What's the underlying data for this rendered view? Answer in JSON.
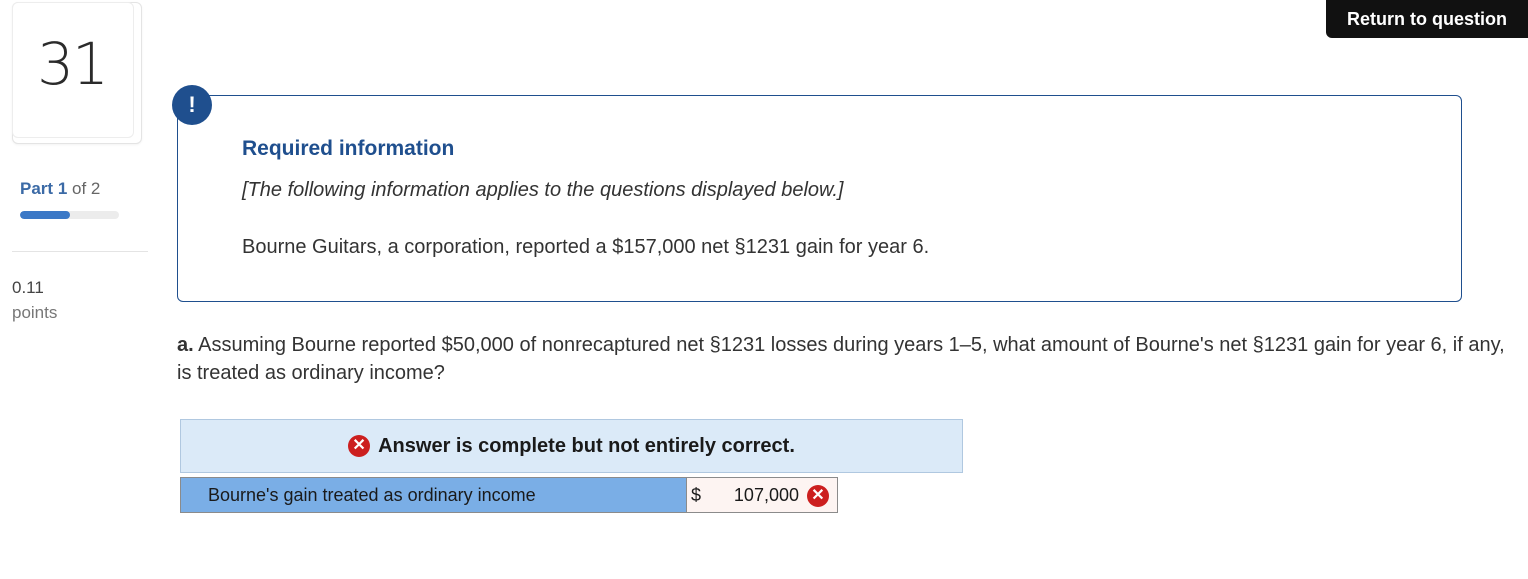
{
  "question_number": "31",
  "part": {
    "label": "Part",
    "current": "1",
    "of_text": "of 2",
    "progress": 0.5
  },
  "points": {
    "value": "0.11",
    "label": "points"
  },
  "header": {
    "return_label": "Return to question"
  },
  "alert_icon": "!",
  "info": {
    "title": "Required information",
    "note": "[The following information applies to the questions displayed below.]",
    "text": "Bourne Guitars, a corporation, reported a $157,000 net §1231 gain for year 6."
  },
  "question": {
    "prefix": "a.",
    "text": "Assuming Bourne reported $50,000 of nonrecaptured net §1231 losses during years 1–5, what amount of Bourne's net §1231 gain for year 6, if any, is treated as ordinary income?"
  },
  "answer": {
    "banner": "Answer is complete but not entirely correct.",
    "row_label": "Bourne's gain treated as ordinary income",
    "currency": "$",
    "value": "107,000"
  },
  "icons": {
    "banner_status": "x-circle-icon",
    "value_status": "x-circle-icon"
  },
  "colors": {
    "brand_blue": "#1f4f8e",
    "error_red": "#cc1f1f",
    "banner_bg": "#dbeaf8",
    "label_bg": "#7aaee6"
  }
}
